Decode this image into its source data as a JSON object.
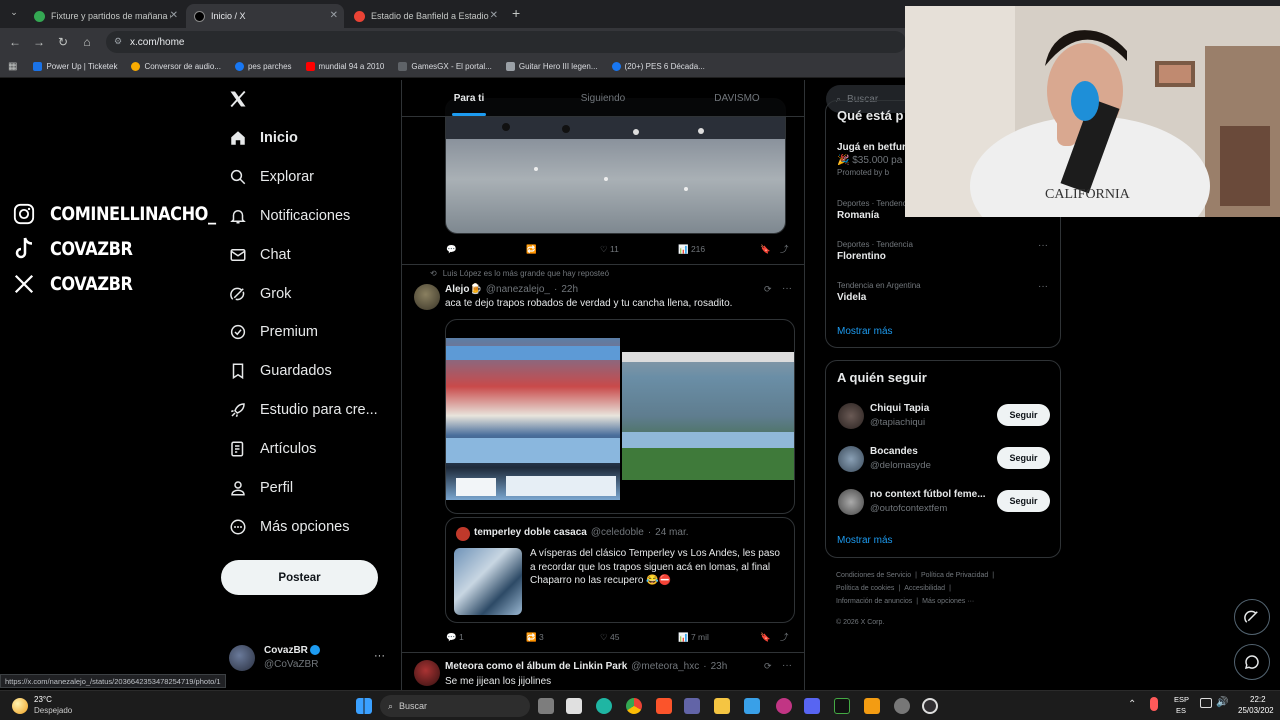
{
  "browser": {
    "tabs": [
      {
        "title": "Fixture y partidos de mañana de",
        "active": false
      },
      {
        "title": "Inicio / X",
        "active": true
      },
      {
        "title": "Estadio de Banfield a Estadio Al",
        "active": false
      }
    ],
    "new_tab": "+",
    "url": "x.com/home",
    "bookmarks": [
      "Power Up | Ticketek",
      "Conversor de audio...",
      "pes parches",
      "mundial 94 a 2010",
      "GamesGX - El portal...",
      "Guitar Hero III legen...",
      "(20+) PES 6 Década..."
    ]
  },
  "overlay": {
    "social": [
      {
        "icon": "instagram-icon",
        "handle": "COMINELLINACHO_"
      },
      {
        "icon": "tiktok-icon",
        "handle": "COVAZBR"
      },
      {
        "icon": "x-icon",
        "handle": "COVAZBR"
      }
    ]
  },
  "sidebar": {
    "items": [
      {
        "label": "Inicio",
        "icon": "home-icon"
      },
      {
        "label": "Explorar",
        "icon": "search-icon"
      },
      {
        "label": "Notificaciones",
        "icon": "bell-icon"
      },
      {
        "label": "Chat",
        "icon": "mail-icon"
      },
      {
        "label": "Grok",
        "icon": "grok-icon"
      },
      {
        "label": "Premium",
        "icon": "verified-icon"
      },
      {
        "label": "Guardados",
        "icon": "bookmark-icon"
      },
      {
        "label": "Estudio para cre...",
        "icon": "rocket-icon"
      },
      {
        "label": "Artículos",
        "icon": "article-icon"
      },
      {
        "label": "Perfil",
        "icon": "person-icon"
      },
      {
        "label": "Más opciones",
        "icon": "more-circle-icon"
      }
    ],
    "post_button": "Postear",
    "account": {
      "name": "CovazBR",
      "handle": "@CoVaZBR",
      "more": "···"
    }
  },
  "feed": {
    "tabs": [
      "Para ti",
      "Siguiendo",
      "DAVISMO"
    ],
    "tweet1": {
      "likes": "11",
      "views": "216"
    },
    "tweet2": {
      "repost_label": "Luis López es lo más grande que hay reposteó",
      "author": "Alejo🍺",
      "handle": "@nanezalejo_",
      "time": "22h",
      "text": "aca te dejo trapos robados de verdad y tu cancha llena, rosadito.",
      "quote": {
        "author": "temperley doble casaca",
        "handle": "@celedoble",
        "time": "24 mar.",
        "text": "A vísperas del clásico Temperley vs Los Andes, les paso a recordar que los trapos siguen acá en lomas, al final Chaparro no las recupero 😂⛔"
      },
      "replies": "1",
      "reposts": "3",
      "likes": "45",
      "views": "7 mil"
    },
    "tweet3": {
      "author": "Meteora como el álbum de Linkin Park",
      "handle": "@meteora_hxc",
      "time": "23h",
      "text": "Se me jijean los jijolines"
    }
  },
  "right": {
    "search_placeholder": "Buscar",
    "trends_header": "Qué está p",
    "promo": {
      "title": "Jugá en betfur",
      "sub": "🎉 $35.000 pa",
      "promoted": "Promoted by b"
    },
    "trends": [
      {
        "cat": "Deportes · Tendenc",
        "name": "Romanía"
      },
      {
        "cat": "Deportes · Tendencia",
        "name": "Florentino"
      },
      {
        "cat": "Tendencia en Argentina",
        "name": "Videla"
      }
    ],
    "show_more": "Mostrar más",
    "follow_title": "A quién seguir",
    "follow": [
      {
        "name": "Chiqui Tapia",
        "handle": "@tapiachiqui"
      },
      {
        "name": "Bocandes",
        "handle": "@delomasyde"
      },
      {
        "name": "no context fútbol feme...",
        "handle": "@outofcontextfem"
      }
    ],
    "follow_btn": "Seguir",
    "footer": [
      "Condiciones de Servicio",
      "Política de Privacidad",
      "Política de cookies",
      "Accesibilidad",
      "Información de anuncios",
      "Más opciones ···",
      "© 2026 X Corp."
    ]
  },
  "status_url": "https://x.com/nanezalejo_/status/2036642353478254719/photo/1",
  "taskbar": {
    "weather_temp": "23°C",
    "weather_desc": "Despejado",
    "search": "Buscar",
    "lang": "ESP",
    "lang2": "ES",
    "time": "22:2",
    "date": "25/03/202"
  }
}
